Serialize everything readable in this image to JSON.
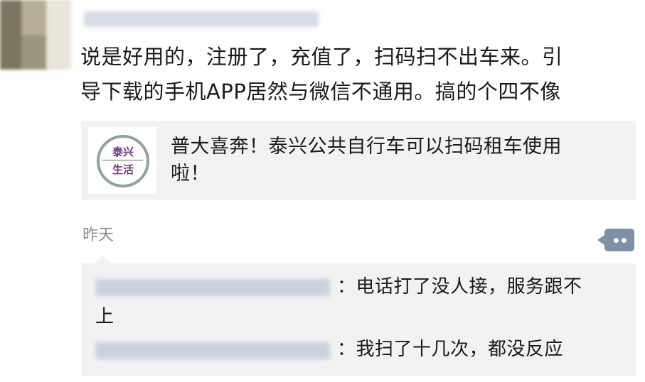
{
  "post": {
    "text_line1": "说是好用的，注册了，充值了，扫码扫不出车来。引",
    "text_line2": "导下载的手机APP居然与微信不通用。搞的个四不像"
  },
  "link_card": {
    "logo_line1": "泰兴",
    "logo_line2": "生活",
    "title_line1": "普大喜奔！泰兴公共自行车可以扫码租车使用",
    "title_line2": "啦！"
  },
  "timestamp": "昨天",
  "more_icon": "comment-more-icon",
  "comments": [
    {
      "text_line1": "：电话打了没人接，服务跟不",
      "text_line2": "上"
    },
    {
      "text_line1": "：我扫了十几次，都没反应"
    }
  ],
  "colors": {
    "more_button": "#7e90a8",
    "card_bg": "#f2f2f2",
    "logo_text": "#6b3b86",
    "logo_ring": "#8da594"
  }
}
